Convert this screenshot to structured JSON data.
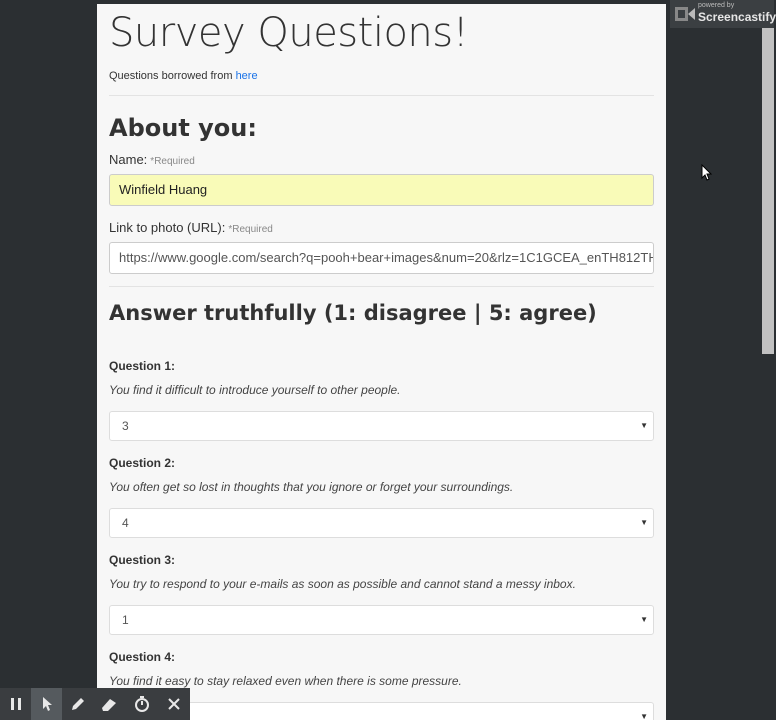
{
  "page": {
    "title": "Survey Questions!",
    "credit_text": "Questions borrowed from ",
    "credit_link": "here"
  },
  "about": {
    "heading": "About you:",
    "name_label": "Name:",
    "name_required": "*Required",
    "name_value": "Winfield Huang",
    "photo_label": "Link to photo (URL):",
    "photo_required": "*Required",
    "photo_value": "https://www.google.com/search?q=pooh+bear+images&num=20&rlz=1C1GCEA_enTH812TH"
  },
  "answer": {
    "heading": "Answer truthfully (1: disagree | 5: agree)"
  },
  "questions": [
    {
      "label": "Question 1:",
      "text": "You find it difficult to introduce yourself to other people.",
      "value": "3"
    },
    {
      "label": "Question 2:",
      "text": "You often get so lost in thoughts that you ignore or forget your surroundings.",
      "value": "4"
    },
    {
      "label": "Question 3:",
      "text": "You try to respond to your e-mails as soon as possible and cannot stand a messy inbox.",
      "value": "1"
    },
    {
      "label": "Question 4:",
      "text": "You find it easy to stay relaxed even when there is some pressure.",
      "value": ""
    }
  ],
  "badge": {
    "small": "powered by",
    "big": "Screencastify"
  },
  "icons": {
    "select_caret": "caret-down-icon",
    "toolbar": [
      "pause-icon",
      "pointer-icon",
      "pen-icon",
      "eraser-icon",
      "timer-icon",
      "close-icon"
    ]
  },
  "colors": {
    "name_field_bg": "#f9fbb8",
    "link": "#1a73e8",
    "backdrop": "#2b2f32"
  }
}
